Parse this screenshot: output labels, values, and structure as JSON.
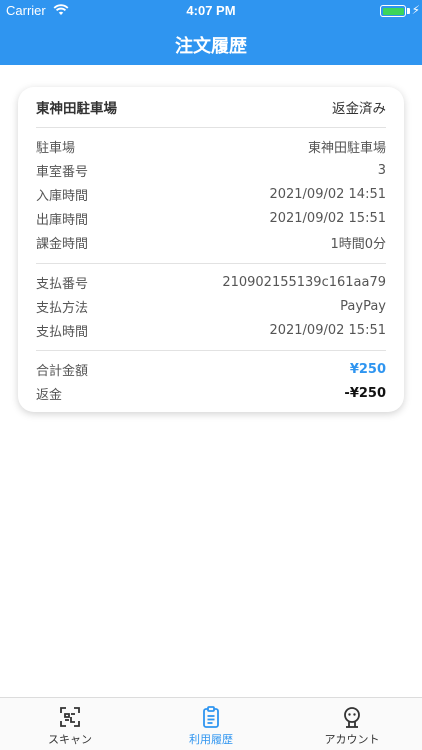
{
  "status_bar": {
    "carrier": "Carrier",
    "time": "4:07 PM"
  },
  "nav": {
    "title": "注文履歴"
  },
  "order": {
    "parking_name": "東神田駐車場",
    "status": "返金済み",
    "details": [
      {
        "label": "駐車場",
        "value": "東神田駐車場"
      },
      {
        "label": "車室番号",
        "value": "3"
      },
      {
        "label": "入庫時間",
        "value": "2021/09/02 14:51"
      },
      {
        "label": "出庫時間",
        "value": "2021/09/02 15:51"
      },
      {
        "label": "課金時間",
        "value": "1時間0分"
      }
    ],
    "payment": [
      {
        "label": "支払番号",
        "value": "210902155139c161aa79"
      },
      {
        "label": "支払方法",
        "value": "PayPay"
      },
      {
        "label": "支払時間",
        "value": "2021/09/02 15:51"
      }
    ],
    "total_label": "合計金額",
    "total_value": "¥250",
    "refund_label": "返金",
    "refund_value": "-¥250"
  },
  "tabs": [
    {
      "label": "スキャン",
      "icon": "scan-icon"
    },
    {
      "label": "利用履歴",
      "icon": "history-icon"
    },
    {
      "label": "アカウント",
      "icon": "account-icon"
    }
  ],
  "colors": {
    "accent": "#2f95f0",
    "battery": "#3cd55b"
  }
}
